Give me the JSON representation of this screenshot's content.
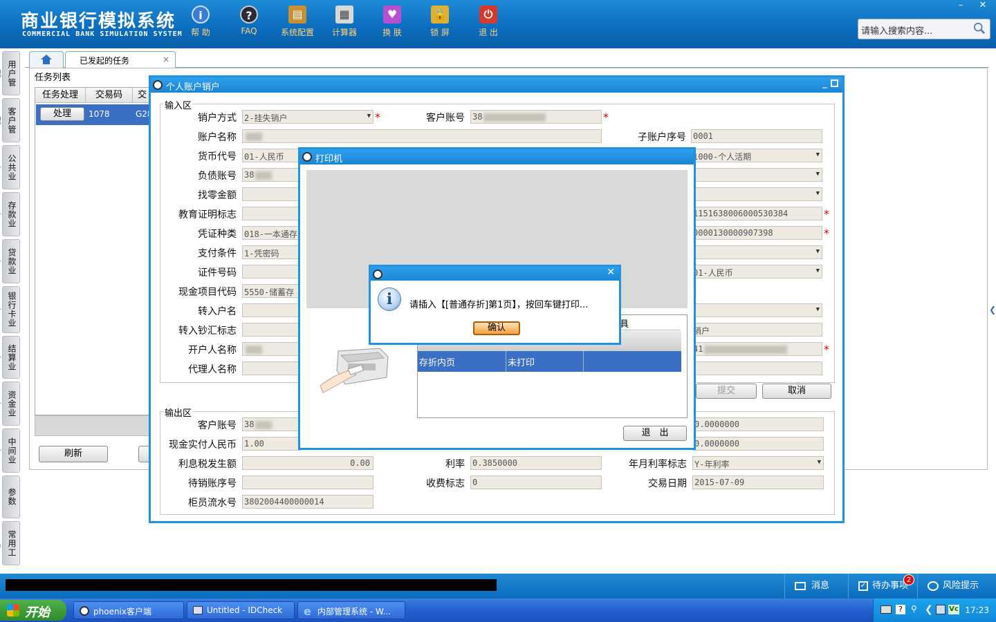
{
  "app": {
    "title_cn": "商业银行模拟系统",
    "title_en": "COMMERCIAL BANK SIMULATION SYSTEM",
    "toolbar": [
      {
        "label": "帮 助",
        "icon": "help-icon"
      },
      {
        "label": "FAQ",
        "icon": "faq-icon"
      },
      {
        "label": "系统配置",
        "icon": "config-icon"
      },
      {
        "label": "计算器",
        "icon": "calculator-icon"
      },
      {
        "label": "换 肤",
        "icon": "skin-icon"
      },
      {
        "label": "锁 屏",
        "icon": "lock-icon"
      },
      {
        "label": "退 出",
        "icon": "exit-icon"
      }
    ],
    "search_placeholder": "请输入搜索内容...",
    "window_controls": {
      "minimize": "–",
      "close": "✕"
    }
  },
  "leftnav": [
    "用户管理",
    "客户管理",
    "公共业务",
    "存款业务",
    "贷款业务",
    "银行卡业务",
    "结算业务",
    "资金业务",
    "中间业务",
    "参数",
    "常用工具"
  ],
  "tabs": {
    "active": "已发起的任务",
    "close": "×"
  },
  "tasklist": {
    "label": "任务列表",
    "headers": [
      "任务处理",
      "交易码",
      "交"
    ],
    "row": {
      "action": "处理",
      "code": "1078",
      "partial": "G28"
    },
    "refresh": "刷新"
  },
  "dialog": {
    "title": "个人账户销户",
    "input_section": "输入区",
    "output_section": "输出区",
    "labels": {
      "close_method": "销户方式",
      "customer_account": "客户账号",
      "account_name": "账户名称",
      "sub_account_no": "子账户序号",
      "currency_code": "货币代号",
      "liability_account": "负债账号",
      "change_amount": "找零金额",
      "education_cert": "教育证明标志",
      "voucher_type": "凭证种类",
      "payment_condition": "支付条件",
      "id_number": "证件号码",
      "cash_item_code": "现金项目代码",
      "transfer_name": "转入户名",
      "transfer_cash_flag": "转入钞汇标志",
      "opener_name": "开户人名称",
      "agent_name": "代理人名称",
      "out_customer_account": "客户账号",
      "cash_paid_rmb": "现金实付人民币",
      "interest_tax": "利息税发生额",
      "interest_rate": "利率",
      "rate_flag": "年月利率标志",
      "pending_account": "待销账序号",
      "fee_flag": "收费标志",
      "trade_date": "交易日期",
      "teller_serial": "柜员流水号"
    },
    "values": {
      "close_method": "2-挂失销户",
      "customer_account_prefix": "38",
      "sub_account_no": "0001",
      "currency_code": "01-人民币",
      "liability_account_prefix": "38",
      "right_product": "1000-个人活期",
      "right_r5": "1151638006000530384",
      "voucher_type": "018-一本通存",
      "right_r6": "0000130000907398",
      "payment_condition": "1-凭密码",
      "right_r8": "01-人民币",
      "cash_item_code": "5550-储蓄存",
      "right_r11": "销户",
      "right_r12_prefix": "41",
      "out_customer_account_prefix": "38",
      "out_right_1": "0.0000000",
      "cash_paid_rmb": "1.00",
      "out_right_2": "0.0000000",
      "interest_tax": "0.00",
      "interest_rate": "0.3850000",
      "rate_flag": "Y-年利率",
      "fee_flag": "0",
      "trade_date": "2015-07-09",
      "teller_serial": "3802004400000014"
    },
    "buttons": {
      "submit": "提交",
      "cancel": "取消"
    }
  },
  "printer": {
    "title": "打印机",
    "table_header_partial": "具",
    "row": {
      "col1": "存折内页",
      "col2": "未打印"
    },
    "exit": "退　出"
  },
  "alert": {
    "message": "请插入【[普通存折]第1页】，按回车键打印...",
    "confirm": "确认",
    "close": "✕"
  },
  "statusbar": {
    "message": "消息",
    "todo": "待办事项",
    "todo_count": "2",
    "risk": "风险提示"
  },
  "taskbar": {
    "start": "开始",
    "items": [
      "phoenix客户端",
      "Untitled - IDCheck",
      "内部管理系统 - W..."
    ],
    "clock": "17:23"
  },
  "colors": {
    "accent": "#1a86d4",
    "selected_row": "#3a6fc4",
    "field_bg": "#eeeae2",
    "required": "#dd0000"
  }
}
